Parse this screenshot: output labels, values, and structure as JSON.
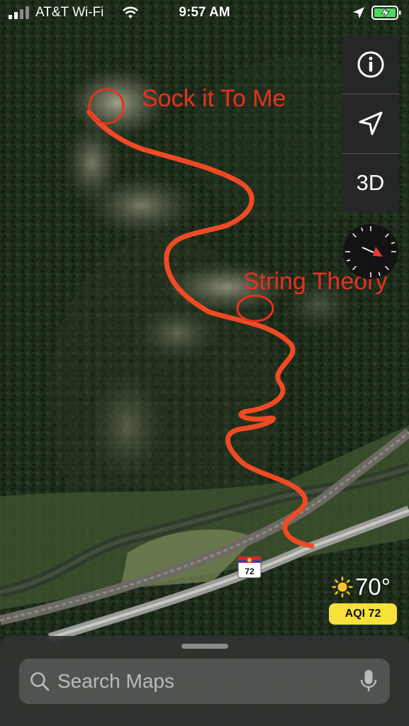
{
  "status_bar": {
    "carrier": "AT&T Wi-Fi",
    "time": "9:57 AM"
  },
  "map_controls": {
    "info_icon": "info-icon",
    "location_icon": "location-arrow-icon",
    "view_3d_label": "3D"
  },
  "annotations": {
    "route_1_label": "Sock it To Me",
    "route_2_label": "String Theory",
    "color": "#e8311e"
  },
  "highway": {
    "number": "72"
  },
  "weather": {
    "temperature": "70°",
    "aqi": "AQI 72"
  },
  "search": {
    "placeholder": "Search Maps"
  },
  "colors": {
    "accent_route": "#f04a24",
    "aqi_badge": "#f6e23a",
    "battery_green": "#4cd964"
  }
}
